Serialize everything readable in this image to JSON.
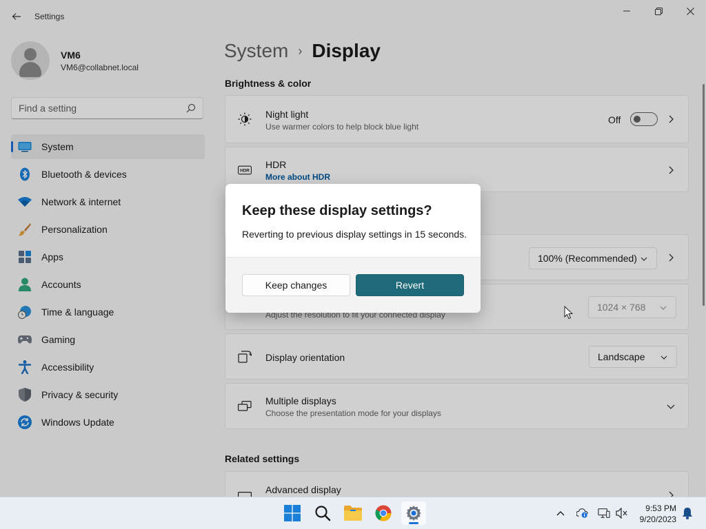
{
  "window": {
    "title": "Settings",
    "controls": [
      "minimize",
      "restore",
      "close"
    ]
  },
  "profile": {
    "name": "VM6",
    "email": "VM6@collabnet.local"
  },
  "search": {
    "placeholder": "Find a setting"
  },
  "sidebar": {
    "items": [
      {
        "label": "System",
        "icon": "system-icon",
        "active": true
      },
      {
        "label": "Bluetooth & devices",
        "icon": "bluetooth-icon"
      },
      {
        "label": "Network & internet",
        "icon": "wifi-icon"
      },
      {
        "label": "Personalization",
        "icon": "brush-icon"
      },
      {
        "label": "Apps",
        "icon": "apps-icon"
      },
      {
        "label": "Accounts",
        "icon": "accounts-icon"
      },
      {
        "label": "Time & language",
        "icon": "globe-clock-icon"
      },
      {
        "label": "Gaming",
        "icon": "gamepad-icon"
      },
      {
        "label": "Accessibility",
        "icon": "accessibility-icon"
      },
      {
        "label": "Privacy & security",
        "icon": "shield-icon"
      },
      {
        "label": "Windows Update",
        "icon": "update-icon"
      }
    ]
  },
  "breadcrumb": {
    "parent": "System",
    "separator": "›",
    "current": "Display"
  },
  "main": {
    "brightness_section": "Brightness & color",
    "night_light": {
      "title": "Night light",
      "subtitle": "Use warmer colors to help block blue light",
      "state": "Off"
    },
    "hdr": {
      "title": "HDR",
      "link": "More about HDR"
    },
    "scale": {
      "value": "100% (Recommended)"
    },
    "resolution": {
      "subtitle": "Adjust the resolution to fit your connected display",
      "value": "1024 × 768"
    },
    "orientation": {
      "title": "Display orientation",
      "value": "Landscape"
    },
    "multiple": {
      "title": "Multiple displays",
      "subtitle": "Choose the presentation mode for your displays"
    },
    "related_section": "Related settings",
    "advanced": {
      "title": "Advanced display"
    }
  },
  "dialog": {
    "title": "Keep these display settings?",
    "message": "Reverting to previous display settings in 15 seconds.",
    "keep_label": "Keep changes",
    "revert_label": "Revert"
  },
  "taskbar": {
    "apps": [
      "start-icon",
      "search-icon",
      "file-explorer-icon",
      "chrome-icon",
      "settings-icon"
    ],
    "clock": {
      "time": "9:53 PM",
      "date": "9/20/2023"
    }
  },
  "colors": {
    "accent": "#1f6a7a",
    "nav_indicator": "#1a6ed8",
    "link": "#005a9e"
  }
}
